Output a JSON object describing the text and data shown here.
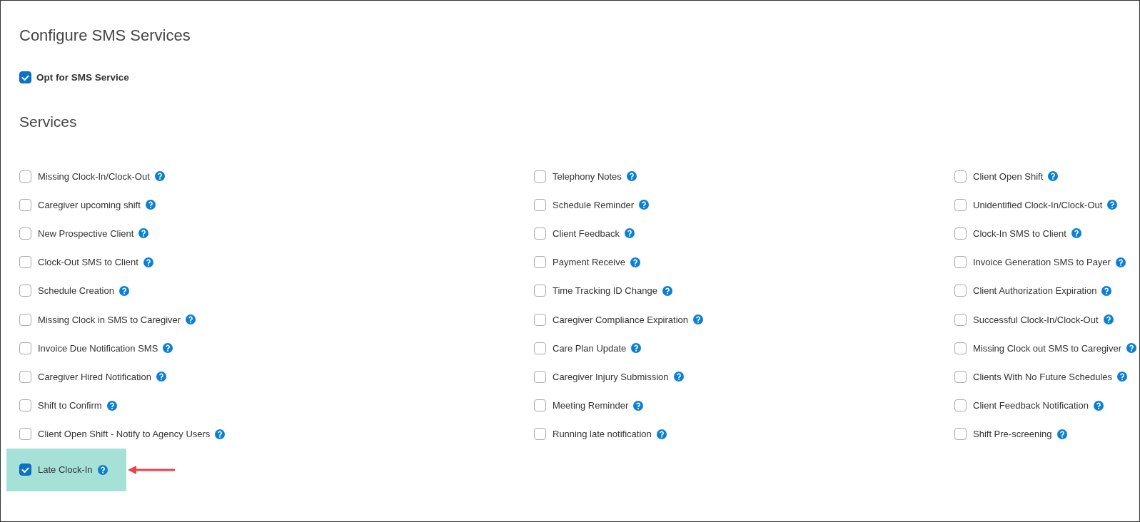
{
  "title": "Configure SMS Services",
  "opt_in": {
    "label": "Opt for SMS Service",
    "checked": true
  },
  "services_heading": "Services",
  "columns": [
    {
      "items": [
        {
          "label": "Missing Clock-In/Clock-Out",
          "checked": false,
          "highlighted": false
        },
        {
          "label": "Caregiver upcoming shift",
          "checked": false,
          "highlighted": false
        },
        {
          "label": "New Prospective Client",
          "checked": false,
          "highlighted": false
        },
        {
          "label": "Clock-Out SMS to Client",
          "checked": false,
          "highlighted": false
        },
        {
          "label": "Schedule Creation",
          "checked": false,
          "highlighted": false
        },
        {
          "label": "Missing Clock in SMS to Caregiver",
          "checked": false,
          "highlighted": false
        },
        {
          "label": "Invoice Due Notification SMS",
          "checked": false,
          "highlighted": false
        },
        {
          "label": "Caregiver Hired Notification",
          "checked": false,
          "highlighted": false
        },
        {
          "label": "Shift to Confirm",
          "checked": false,
          "highlighted": false
        },
        {
          "label": "Client Open Shift - Notify to Agency Users",
          "checked": false,
          "highlighted": false
        },
        {
          "label": "Late Clock-In",
          "checked": true,
          "highlighted": true
        }
      ]
    },
    {
      "items": [
        {
          "label": "Telephony Notes",
          "checked": false,
          "highlighted": false
        },
        {
          "label": "Schedule Reminder",
          "checked": false,
          "highlighted": false
        },
        {
          "label": "Client Feedback",
          "checked": false,
          "highlighted": false
        },
        {
          "label": "Payment Receive",
          "checked": false,
          "highlighted": false
        },
        {
          "label": "Time Tracking ID Change",
          "checked": false,
          "highlighted": false
        },
        {
          "label": "Caregiver Compliance Expiration",
          "checked": false,
          "highlighted": false
        },
        {
          "label": "Care Plan Update",
          "checked": false,
          "highlighted": false
        },
        {
          "label": "Caregiver Injury Submission",
          "checked": false,
          "highlighted": false
        },
        {
          "label": "Meeting Reminder",
          "checked": false,
          "highlighted": false
        },
        {
          "label": "Running late notification",
          "checked": false,
          "highlighted": false
        }
      ]
    },
    {
      "items": [
        {
          "label": "Client Open Shift",
          "checked": false,
          "highlighted": false
        },
        {
          "label": "Unidentified Clock-In/Clock-Out",
          "checked": false,
          "highlighted": false
        },
        {
          "label": "Clock-In SMS to Client",
          "checked": false,
          "highlighted": false
        },
        {
          "label": "Invoice Generation SMS to Payer",
          "checked": false,
          "highlighted": false
        },
        {
          "label": "Client Authorization Expiration",
          "checked": false,
          "highlighted": false
        },
        {
          "label": "Successful Clock-In/Clock-Out",
          "checked": false,
          "highlighted": false
        },
        {
          "label": "Missing Clock out SMS to Caregiver",
          "checked": false,
          "highlighted": false
        },
        {
          "label": "Clients With No Future Schedules",
          "checked": false,
          "highlighted": false
        },
        {
          "label": "Client Feedback Notification",
          "checked": false,
          "highlighted": false
        },
        {
          "label": "Shift Pre-screening",
          "checked": false,
          "highlighted": false
        }
      ]
    }
  ]
}
